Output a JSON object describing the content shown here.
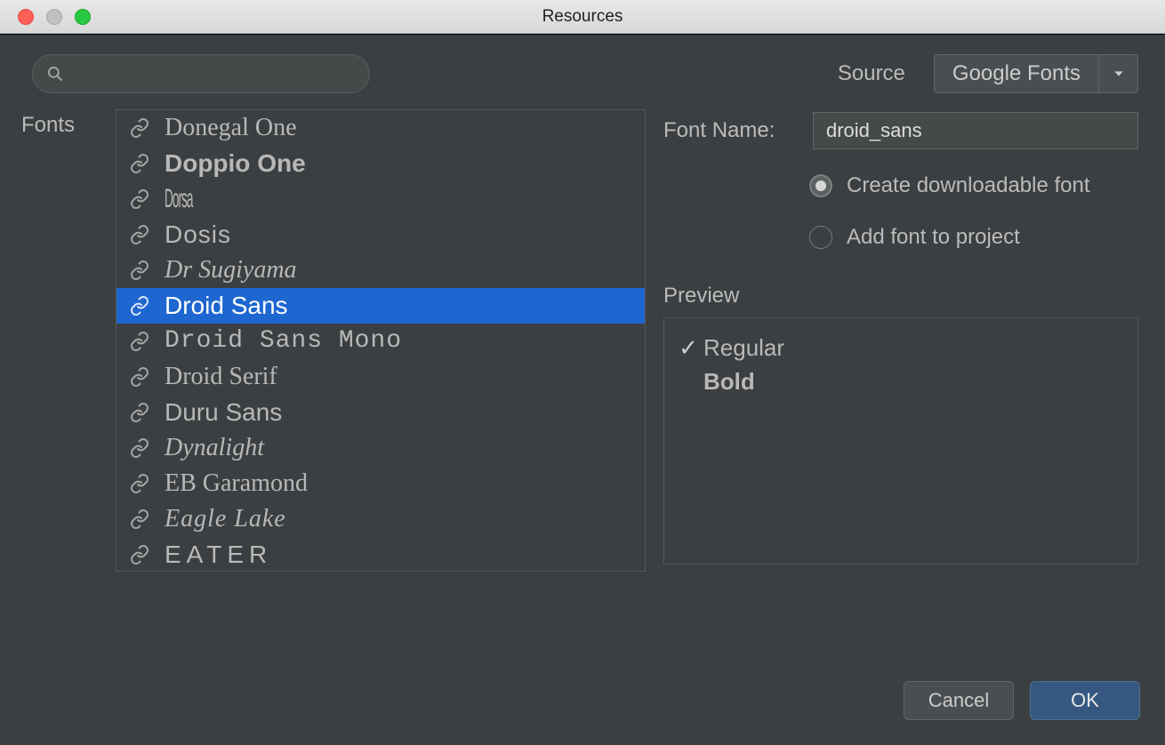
{
  "window": {
    "title": "Resources"
  },
  "search": {
    "value": "",
    "placeholder": ""
  },
  "source": {
    "label": "Source",
    "selected": "Google Fonts"
  },
  "sidebar": {
    "fonts_label": "Fonts"
  },
  "font_list": {
    "selected_index": 5,
    "items": [
      {
        "name": "Donegal One",
        "cls": "f-donegal"
      },
      {
        "name": "Doppio One",
        "cls": "f-doppio"
      },
      {
        "name": "Dorsa",
        "cls": "f-dorsa"
      },
      {
        "name": "Dosis",
        "cls": "f-dosis"
      },
      {
        "name": "Dr Sugiyama",
        "cls": "f-drsugi"
      },
      {
        "name": "Droid Sans",
        "cls": "f-droidsans"
      },
      {
        "name": "Droid Sans Mono",
        "cls": "f-droidmono"
      },
      {
        "name": "Droid Serif",
        "cls": "f-droidserif"
      },
      {
        "name": "Duru Sans",
        "cls": "f-duru"
      },
      {
        "name": "Dynalight",
        "cls": "f-dynalight"
      },
      {
        "name": "EB Garamond",
        "cls": "f-ebg"
      },
      {
        "name": "Eagle Lake",
        "cls": "f-eagle"
      },
      {
        "name": "EATER",
        "cls": "f-eater"
      }
    ]
  },
  "details": {
    "font_name_label": "Font Name:",
    "font_name_value": "droid_sans",
    "option_downloadable": "Create downloadable font",
    "option_add_project": "Add font to project",
    "selected_option": 0
  },
  "preview": {
    "label": "Preview",
    "styles": [
      {
        "name": "Regular",
        "checked": true,
        "bold": false
      },
      {
        "name": "Bold",
        "checked": false,
        "bold": true
      }
    ]
  },
  "footer": {
    "cancel": "Cancel",
    "ok": "OK"
  }
}
